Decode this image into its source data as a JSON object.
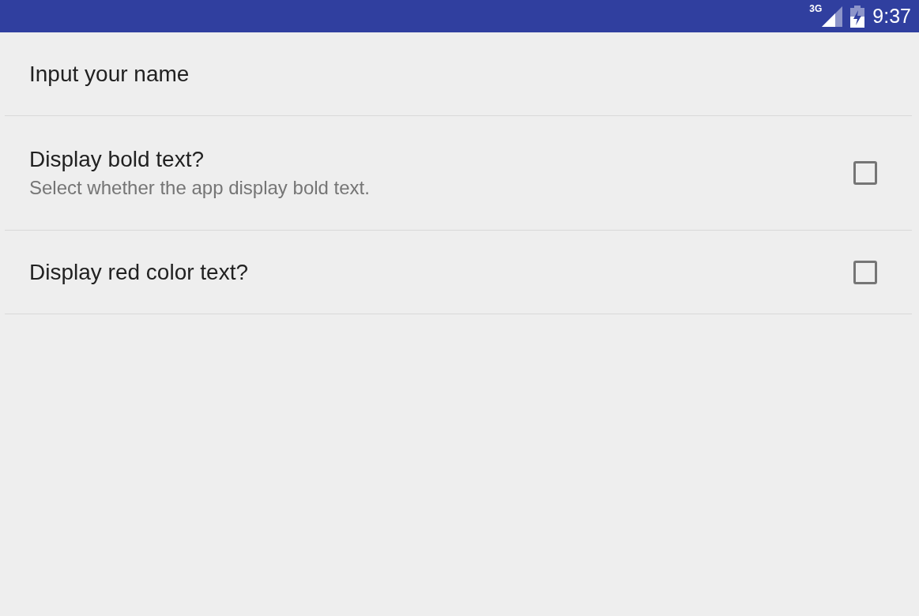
{
  "status_bar": {
    "network": "3G",
    "time": "9:37"
  },
  "preferences": [
    {
      "kind": "text",
      "title": "Input your name"
    },
    {
      "kind": "checkbox",
      "title": "Display bold text?",
      "summary": "Select whether the app display bold text.",
      "checked": false
    },
    {
      "kind": "checkbox",
      "title": "Display red color text?",
      "checked": false
    }
  ]
}
